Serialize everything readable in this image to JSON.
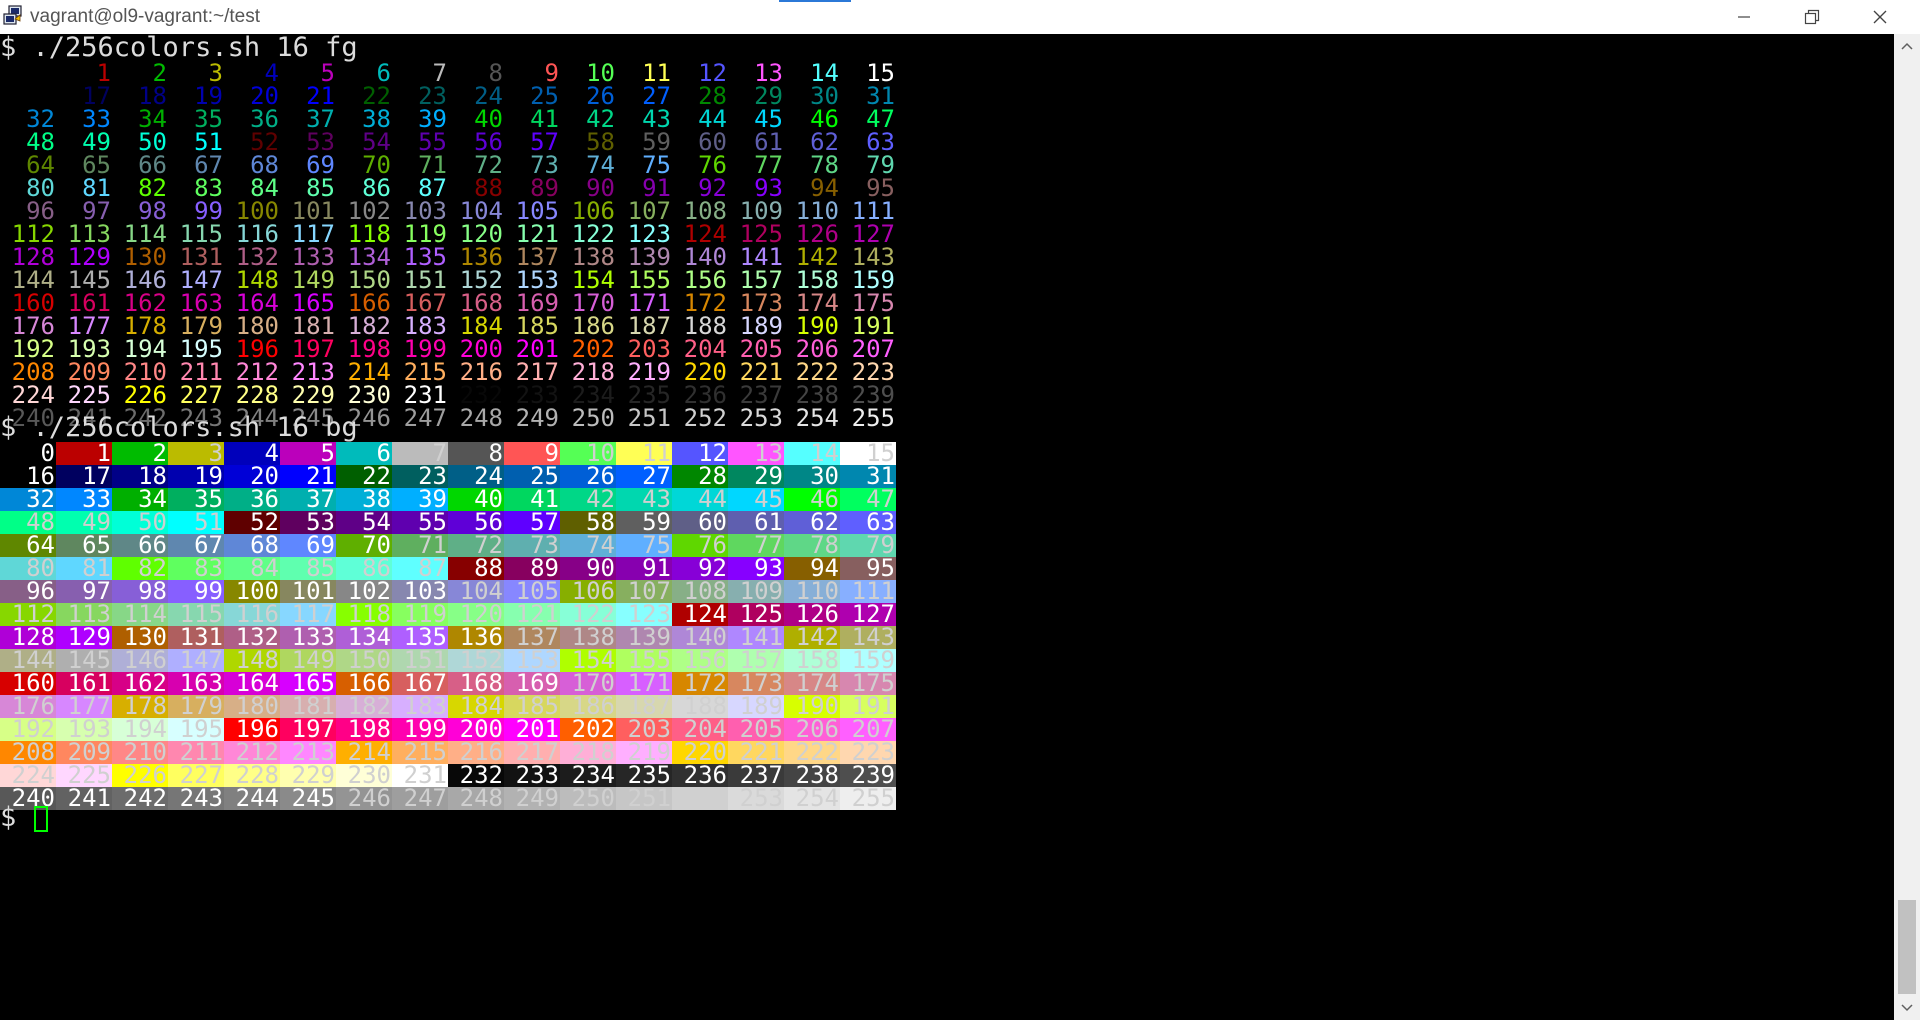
{
  "window": {
    "title": "vagrant@ol9-vagrant:~/test",
    "app_icon": "putty-icon",
    "controls": [
      "minimize-icon",
      "restore-icon",
      "close-icon"
    ]
  },
  "terminal": {
    "command_fg": "$ ./256colors.sh 16 fg",
    "command_bg": "$ ./256colors.sh 16 bg",
    "final_prompt": "$ ",
    "cursor_color": "#00ff00",
    "columns_per_row": 16,
    "cell_start": 0,
    "cell_end": 255,
    "fg_grid_note": "each number printed in its own xterm-256 foreground color on black",
    "bg_grid_note": "each number printed on its own xterm-256 background color"
  },
  "scrollbar": {
    "up_icon": "scroll-up-arrow-icon",
    "down_icon": "scroll-down-arrow-icon",
    "position_fraction": 1.0
  }
}
